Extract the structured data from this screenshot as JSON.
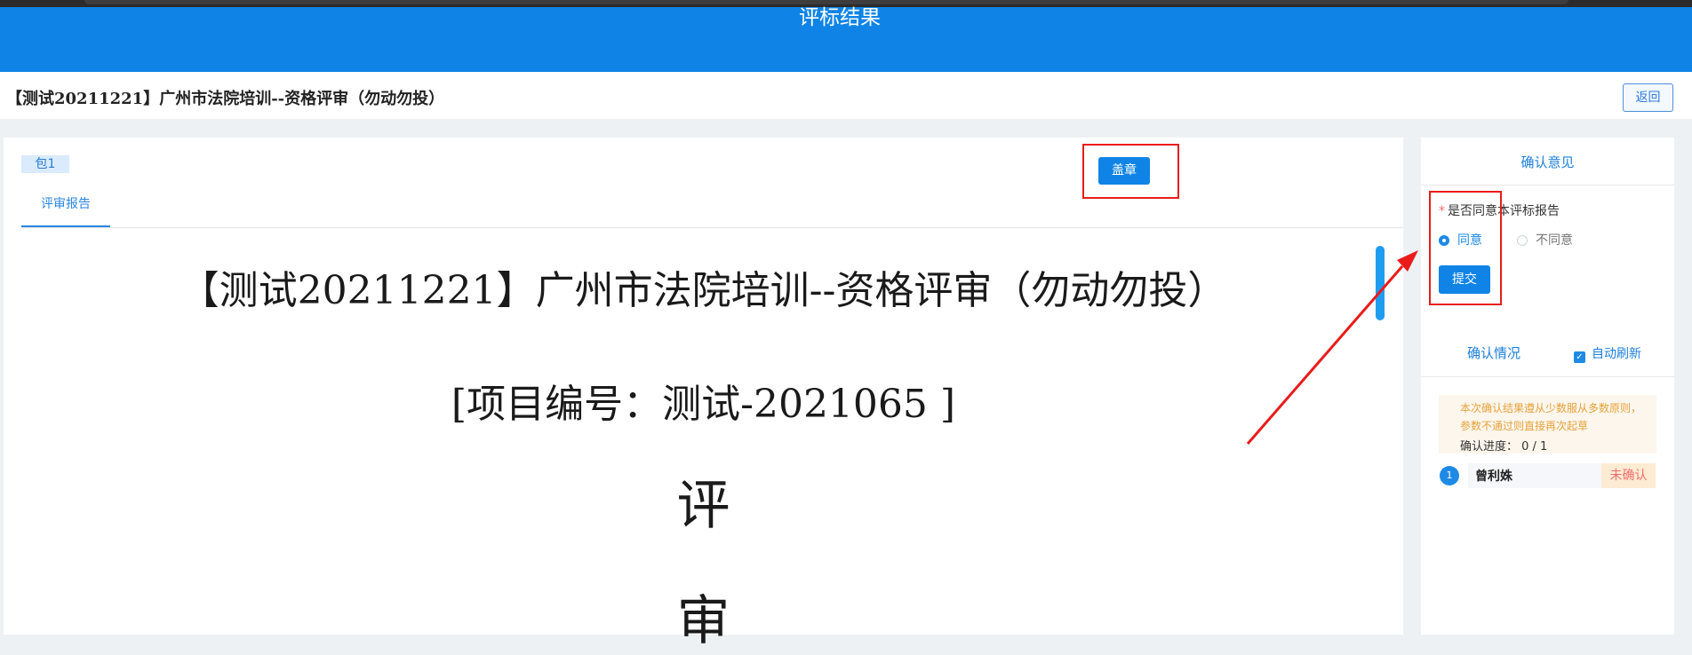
{
  "header": {
    "title": "评标结果"
  },
  "title_bar": {
    "title": "【测试20211221】广州市法院培训--资格评审（勿动勿投）",
    "back_label": "返回"
  },
  "main": {
    "package_tag": "包1",
    "tabs": [
      {
        "label": "评审报告"
      }
    ],
    "seal_label": "盖章",
    "document": {
      "title": "【测试20211221】广州市法院培训--资格评审（勿动勿投）",
      "project_number": "[项目编号：测试-2021065 ]",
      "char1": "评",
      "char2": "审"
    }
  },
  "panel": {
    "title": "确认意见",
    "question": "是否同意本评标报告",
    "options": [
      {
        "label": "同意",
        "selected": true
      },
      {
        "label": "不同意",
        "selected": false
      }
    ],
    "submit_label": "提交",
    "status_title": "确认情况",
    "auto_refresh": {
      "label": "自动刷新",
      "checked": true
    },
    "notice": "本次确认结果遵从少数服从多数原则，参数不通过则直接再次起草",
    "progress": "确认进度： 0 / 1",
    "users": [
      {
        "index": "1",
        "name": "曾利姝",
        "status": "未确认"
      }
    ]
  },
  "colors": {
    "brand": "#0f84e6",
    "annotation": "#ea1b1b",
    "warning": "#e6a23c",
    "danger": "#f56c6c"
  }
}
